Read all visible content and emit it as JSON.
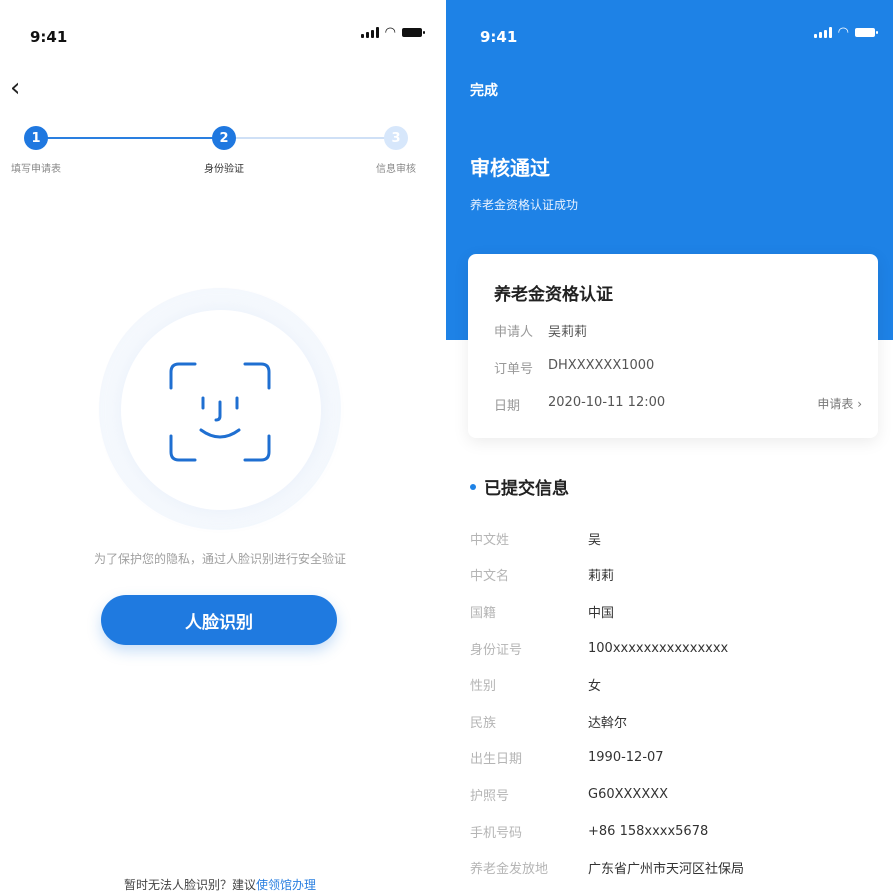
{
  "left": {
    "status": {
      "time": "9:41"
    },
    "back_glyph": "‹",
    "steps": [
      {
        "num": "1",
        "label": "填写申请表"
      },
      {
        "num": "2",
        "label": "身份验证"
      },
      {
        "num": "3",
        "label": "信息审核"
      }
    ],
    "privacy_text": "为了保护您的隐私，通过人脸识别进行安全验证",
    "face_button": "人脸识别",
    "bottom_tip": "暂时无法人脸识别？建议",
    "bottom_link": "使领馆办理"
  },
  "right": {
    "status": {
      "time": "9:41"
    },
    "done": "完成",
    "title": "审核通过",
    "subtitle": "养老金资格认证成功",
    "card": {
      "title": "养老金资格认证",
      "rows": [
        {
          "key": "申请人",
          "value": "吴莉莉"
        },
        {
          "key": "订单号",
          "value": "DHXXXXXX1000"
        },
        {
          "key": "日期",
          "value": "2020-10-11  12:00"
        }
      ],
      "link": "申请表 ›"
    },
    "section_title": "已提交信息",
    "info": [
      {
        "key": "中文姓",
        "value": "吴"
      },
      {
        "key": "中文名",
        "value": "莉莉"
      },
      {
        "key": "国籍",
        "value": "中国"
      },
      {
        "key": "身份证号",
        "value": "100xxxxxxxxxxxxxxx"
      },
      {
        "key": "性别",
        "value": "女"
      },
      {
        "key": "民族",
        "value": "达斡尔"
      },
      {
        "key": "出生日期",
        "value": "1990-12-07"
      },
      {
        "key": "护照号",
        "value": "G60XXXXXX"
      },
      {
        "key": "手机号码",
        "value": "+86 158xxxx5678"
      },
      {
        "key": "养老金发放地",
        "value": "广东省广州市天河区社保局"
      }
    ]
  },
  "colors": {
    "brand_blue": "#1e82e6",
    "button_blue": "#1f7ae0",
    "step_pending": "#d7e7fb"
  },
  "icons": [
    "chevron-left-icon",
    "face-scan-icon",
    "signal-icon",
    "wifi-icon",
    "battery-icon"
  ]
}
